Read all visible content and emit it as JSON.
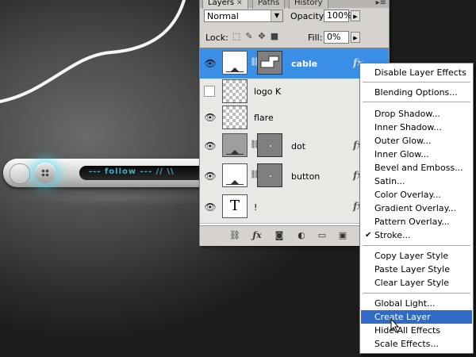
{
  "panel": {
    "tabs": [
      {
        "label": "Layers",
        "close": "✕",
        "active": true
      },
      {
        "label": "Paths",
        "active": false
      },
      {
        "label": "History",
        "active": false
      }
    ],
    "blend_mode": "Normal",
    "opacity_label": "Opacity:",
    "opacity_value": "100%",
    "lock_label": "Lock:",
    "fill_label": "Fill:",
    "fill_value": "0%",
    "layers": [
      {
        "name": "cable",
        "visible": true,
        "selected": true,
        "has_mask": true,
        "has_fx": true,
        "fx_label": "fx"
      },
      {
        "name": "logo K",
        "visible": false,
        "selected": false,
        "has_mask": false,
        "has_fx": false
      },
      {
        "name": "flare",
        "visible": true,
        "selected": false,
        "has_mask": false,
        "has_fx": false
      },
      {
        "name": "dot",
        "visible": true,
        "selected": false,
        "has_mask": true,
        "has_fx": true,
        "fx_label": "fx"
      },
      {
        "name": "button",
        "visible": true,
        "selected": false,
        "has_mask": true,
        "has_fx": true,
        "fx_label": "fx"
      },
      {
        "name": "!",
        "visible": true,
        "selected": false,
        "has_mask": false,
        "has_fx": true,
        "fx_label": "fx",
        "thumb_text": "T"
      }
    ]
  },
  "canvas": {
    "dock_text": "--- follow --- // \\\\",
    "accent": "#3cdcf0"
  },
  "context_menu": {
    "items": [
      {
        "label": "Disable Layer Effects"
      },
      {
        "label": "Blending Options..."
      },
      {
        "label": "Drop Shadow..."
      },
      {
        "label": "Inner Shadow..."
      },
      {
        "label": "Outer Glow..."
      },
      {
        "label": "Inner Glow..."
      },
      {
        "label": "Bevel and Emboss..."
      },
      {
        "label": "Satin..."
      },
      {
        "label": "Color Overlay..."
      },
      {
        "label": "Gradient Overlay..."
      },
      {
        "label": "Pattern Overlay..."
      },
      {
        "label": "Stroke...",
        "checked": true
      },
      {
        "label": "Copy Layer Style"
      },
      {
        "label": "Paste Layer Style"
      },
      {
        "label": "Clear Layer Style"
      },
      {
        "label": "Global Light..."
      },
      {
        "label": "Create Layer",
        "highlighted": true
      },
      {
        "label": "Hide All Effects"
      },
      {
        "label": "Scale Effects..."
      }
    ],
    "highlight_color": "#316ac5"
  },
  "icons": {
    "eye": "eye-icon",
    "chain": "link-icon",
    "checkmark": "check-icon"
  }
}
